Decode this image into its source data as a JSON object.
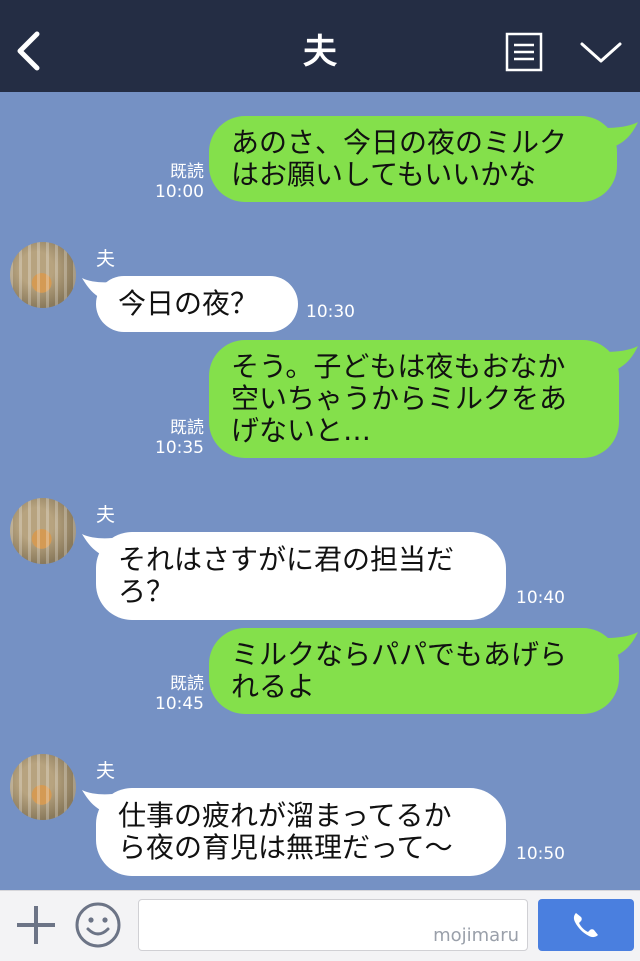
{
  "header": {
    "title": "夫"
  },
  "messages": [
    {
      "dir": "out",
      "text": "あのさ、今日の夜のミルク\nはお願いしてもいいかな",
      "read": "既読",
      "time": "10:00"
    },
    {
      "dir": "in",
      "sender": "夫",
      "text": "今日の夜？",
      "time": "10:30"
    },
    {
      "dir": "out",
      "text": "そう。子どもは夜もおなか\n空いちゃうからミルクをあ\nげないと…",
      "read": "既読",
      "time": "10:35"
    },
    {
      "dir": "in",
      "sender": "夫",
      "text": "それはさすがに君の担当だ\nろ？",
      "time": "10:40"
    },
    {
      "dir": "out",
      "text": "ミルクならパパでもあげら\nれるよ",
      "read": "既読",
      "time": "10:45"
    },
    {
      "dir": "in",
      "sender": "夫",
      "text": "仕事の疲れが溜まってるか\nら夜の育児は無理だって〜",
      "time": "10:50"
    }
  ],
  "footer": {
    "watermark": "mojimaru"
  },
  "colors": {
    "header_bg": "#242d44",
    "chat_bg": "#7591c4",
    "out_bubble": "#84e04b",
    "in_bubble": "#ffffff",
    "call_button": "#4a7fdf"
  },
  "icons": {
    "back": "back-arrow-icon",
    "menu": "menu-list-icon",
    "chevron": "chevron-down-icon",
    "plus": "plus-icon",
    "emoji": "smiley-icon",
    "call": "phone-icon"
  }
}
